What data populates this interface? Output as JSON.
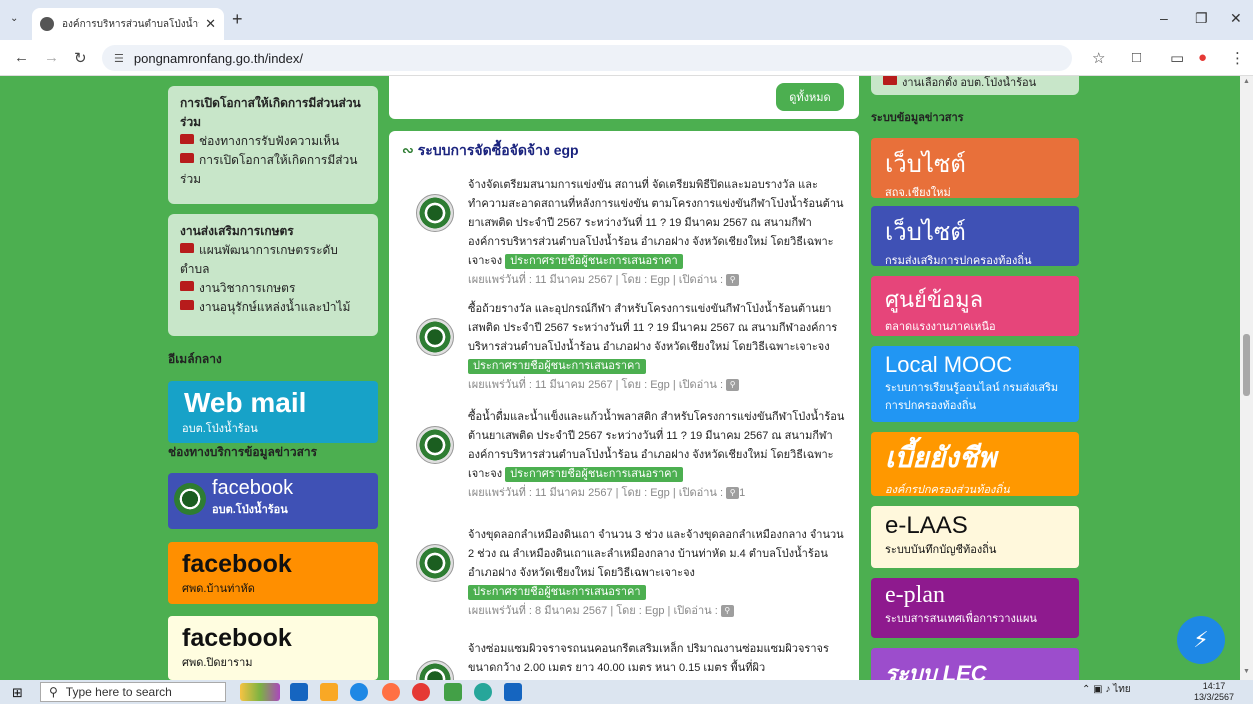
{
  "browser": {
    "tab_title": "องค์การบริหารส่วนตำบลโป่งน้ำร้อน อ.ฝ",
    "url": "pongnamronfang.go.th/index/"
  },
  "left": {
    "box1": {
      "heading": "การเปิดโอกาสให้เกิดการมีส่วนส่วนร่วม",
      "items": [
        "ช่องทางการรับฟังความเห็น",
        "การเปิดโอกาสให้เกิดการมีส่วนร่วม"
      ]
    },
    "box2": {
      "heading": "งานส่งเสริมการเกษตร",
      "items": [
        "แผนพัฒนาการเกษตรระดับตำบล",
        "งานวิชาการเกษตร",
        "งานอนุรักษ์แหล่งน้ำและป่าไม้"
      ]
    },
    "email_heading": "อีเมล์กลาง",
    "webmail": {
      "big": "Web mail",
      "small": "อบต.โป่งน้ำร้อน"
    },
    "channels_heading": "ช่องทางบริการข้อมูลข่าวสาร",
    "fb1": {
      "big": "facebook",
      "small": "อบต.โป่งน้ำร้อน"
    },
    "fb2": {
      "big": "facebook",
      "small": "ศพด.บ้านท่าหัด"
    },
    "fb3": {
      "big": "facebook",
      "small": "ศพด.ปิดยาราม"
    }
  },
  "center": {
    "view_all": "ดูทั้งหมด",
    "egp_title": "ระบบการจัดซื้อจัดจ้าง egp",
    "announce_label": "ประกาศรายชื่อผู้ชนะการเสนอราคา",
    "items": [
      {
        "text": "จ้างจัดเตรียมสนามการแข่งขัน สถานที่ จัดเตรียมพิธีปิดและมอบรางวัล และทำความสะอาดสถานที่หลังการแข่งขัน ตามโครงการแข่งขันกีฬาโป่งน้ำร้อนต้านยาเสพติด ประจำปี 2567 ระหว่างวันที่ 11 ? 19 มีนาคม 2567 ณ สนามกีฬาองค์การบริหารส่วนตำบลโป่งน้ำร้อน อำเภอฝาง จังหวัดเชียงใหม่ โดยวิธีเฉพาะเจาะจง",
        "meta": "เผยแพร่วันที่ : 11 มีนาคม 2567 | โดย : Egp | เปิดอ่าน :",
        "reads": ""
      },
      {
        "text": "ซื้อถ้วยรางวัล และอุปกรณ์กีฬา สำหรับโครงการแข่งขันกีฬาโป่งน้ำร้อนต้านยาเสพติด ประจำปี 2567 ระหว่างวันที่ 11 ? 19 มีนาคม 2567 ณ สนามกีฬาองค์การบริหารส่วนตำบลโป่งน้ำร้อน อำเภอฝาง จังหวัดเชียงใหม่ โดยวิธีเฉพาะเจาะจง",
        "meta": "เผยแพร่วันที่ : 11 มีนาคม 2567 | โดย : Egp | เปิดอ่าน :",
        "reads": ""
      },
      {
        "text": "ซื้อน้ำดื่มและน้ำแข็งและแก้วน้ำพลาสติก สำหรับโครงการแข่งขันกีฬาโป่งน้ำร้อนต้านยาเสพติด ประจำปี 2567 ระหว่างวันที่ 11 ? 19 มีนาคม 2567 ณ สนามกีฬาองค์การบริหารส่วนตำบลโป่งน้ำร้อน อำเภอฝาง จังหวัดเชียงใหม่ โดยวิธีเฉพาะเจาะจง",
        "meta": "เผยแพร่วันที่ : 11 มีนาคม 2567 | โดย : Egp | เปิดอ่าน :",
        "reads": "1"
      },
      {
        "text": "จ้างขุดลอกลำเหมืองดินเถา จำนวน 3 ช่วง และจ้างขุดลอกลำเหมืองกลาง จำนวน 2 ช่วง ณ ลำเหมืองดินเถาและลำเหมืองกลาง บ้านท่าหัด ม.4 ตำบลโป่งน้ำร้อน อำเภอฝาง จังหวัดเชียงใหม่ โดยวิธีเฉพาะเจาะจง",
        "meta": "เผยแพร่วันที่ : 8 มีนาคม 2567 | โดย : Egp | เปิดอ่าน :",
        "reads": ""
      },
      {
        "text": "จ้างซ่อมแซมผิวจราจรถนนคอนกรีตเสริมเหล็ก ปริมาณงานซ่อมแซมผิวจราจร ขนาดกว้าง 2.00 เมตร ยาว 40.00 เมตร หนา 0.15 เมตร พื้นที่ผิว",
        "meta": "",
        "reads": ""
      }
    ]
  },
  "right": {
    "top_link": "งานเลือกตั้ง อบต.โป่งน้ำร้อน",
    "news_heading": "ระบบข้อมูลข่าวสาร",
    "banners": [
      {
        "big": "เว็บไซต์",
        "small": "สถจ.เชียงใหม่",
        "color": "#e8703a"
      },
      {
        "big": "เว็บไซต์",
        "small": "กรมส่งเสริมการปกครองท้องถิ่น",
        "color": "#3f51b5"
      },
      {
        "big": "ศูนย์ข้อมูล",
        "small": "ตลาดแรงงานภาคเหนือ",
        "color": "#e6457a"
      },
      {
        "big": "Local MOOC",
        "small": "ระบบการเรียนรู้ออนไลน์ กรมส่งเสริมการปกครองท้องถิ่น",
        "color": "#2196f3"
      },
      {
        "big": "เบี้ยยังชีพ",
        "small": "องค์กรปกครองส่วนท้องถิ่น",
        "color": "#ff9800"
      },
      {
        "big": "e-LAAS",
        "small": "ระบบบันทึกบัญชีท้องถิ่น",
        "color": "#fff8dc"
      },
      {
        "big": "e-plan",
        "small": "ระบบสารสนเทศเพื่อการวางแผน",
        "color": "#8e1a8e"
      },
      {
        "big": "ระบบ LEC",
        "small": "",
        "color": "#9c4dcc"
      }
    ]
  },
  "taskbar": {
    "search_placeholder": "Type here to search",
    "lang": "ไทย",
    "time": "14:17",
    "date": "13/3/2567"
  }
}
